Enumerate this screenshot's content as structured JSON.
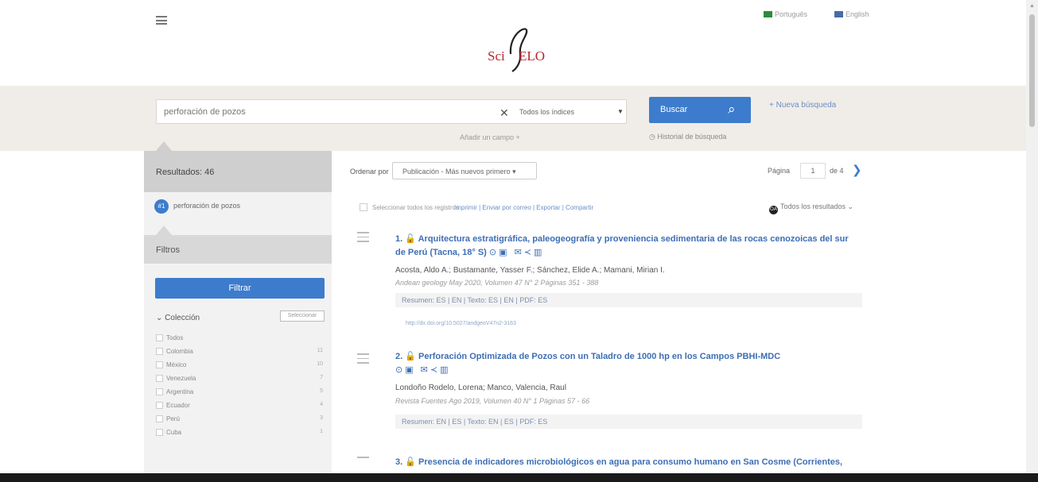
{
  "header": {
    "menu_icon": "hamburger-icon",
    "logo_text": "SciELO",
    "lang_1": "Português",
    "lang_2": "English"
  },
  "search": {
    "query": "perforación de pozos",
    "index": "Todos los índices",
    "button_label": "Buscar",
    "new_search": "+ Nueva búsqueda",
    "add_field": "Añadir un campo +",
    "history": "Historial de búsqueda"
  },
  "results_bar": {
    "results_label": "Resultados: 46",
    "order_label": "Ordenar por",
    "order_value": "Publicación - Más nuevos primero",
    "page_label": "Página",
    "page_value": "1",
    "page_of": "de 4"
  },
  "sidebar": {
    "query_chip": "#1",
    "query_text": "perforación de pozos",
    "filters_title": "Filtros",
    "filter_button": "Filtrar",
    "collection_label": "Colección",
    "select_button": "Seleccionar",
    "collections": [
      {
        "name": "Todos",
        "count": ""
      },
      {
        "name": "Colombia",
        "count": "11"
      },
      {
        "name": "México",
        "count": "10"
      },
      {
        "name": "Venezuela",
        "count": "7"
      },
      {
        "name": "Argentina",
        "count": "5"
      },
      {
        "name": "Ecuador",
        "count": "4"
      },
      {
        "name": "Perú",
        "count": "3"
      },
      {
        "name": "Cuba",
        "count": "1"
      }
    ]
  },
  "toolbar": {
    "select_all": "Seleccionar todos los registros",
    "actions": "Imprimir | Enviar por correo | Exportar | Compartir",
    "open_access": "Todos los resultados"
  },
  "results": [
    {
      "number": "1.",
      "title": "Arquitectura estratigráfica, paleogeografía y proveniencia sedimentaria de las rocas cenozoicas del sur de Perú (Tacna, 18° S)",
      "authors": "Acosta, Aldo A.; Bustamante, Yasser F.; Sánchez, Elide A.; Mamani, Mirian I.",
      "source": "Andean geology  May 2020, Volumen 47 N° 2 Páginas 351 - 388",
      "links": "Resumen: ES | EN | Texto: ES | EN | PDF: ES",
      "doi": "http://dx.doi.org/10.5027/andgeoV47n2-3163"
    },
    {
      "number": "2.",
      "title": "Perforación Optimizada de Pozos con un Taladro de 1000 hp en los Campos PBHI-MDC",
      "authors": "Londoño Rodelo, Lorena; Manco, Valencia, Raul",
      "source": "Revista Fuentes  Ago 2019, Volumen 40 N° 1 Páginas 57 - 66",
      "links": "Resumen: EN | ES | Texto: EN | ES | PDF: ES",
      "doi": ""
    },
    {
      "number": "3.",
      "title": "Presencia de indicadores microbiológicos en agua para consumo humano en San Cosme (Corrientes,",
      "authors": "",
      "source": "",
      "links": "",
      "doi": ""
    }
  ],
  "colors": {
    "accent": "#3d7ccc",
    "search_band": "#f0ede8",
    "link": "#3d6eb5"
  }
}
